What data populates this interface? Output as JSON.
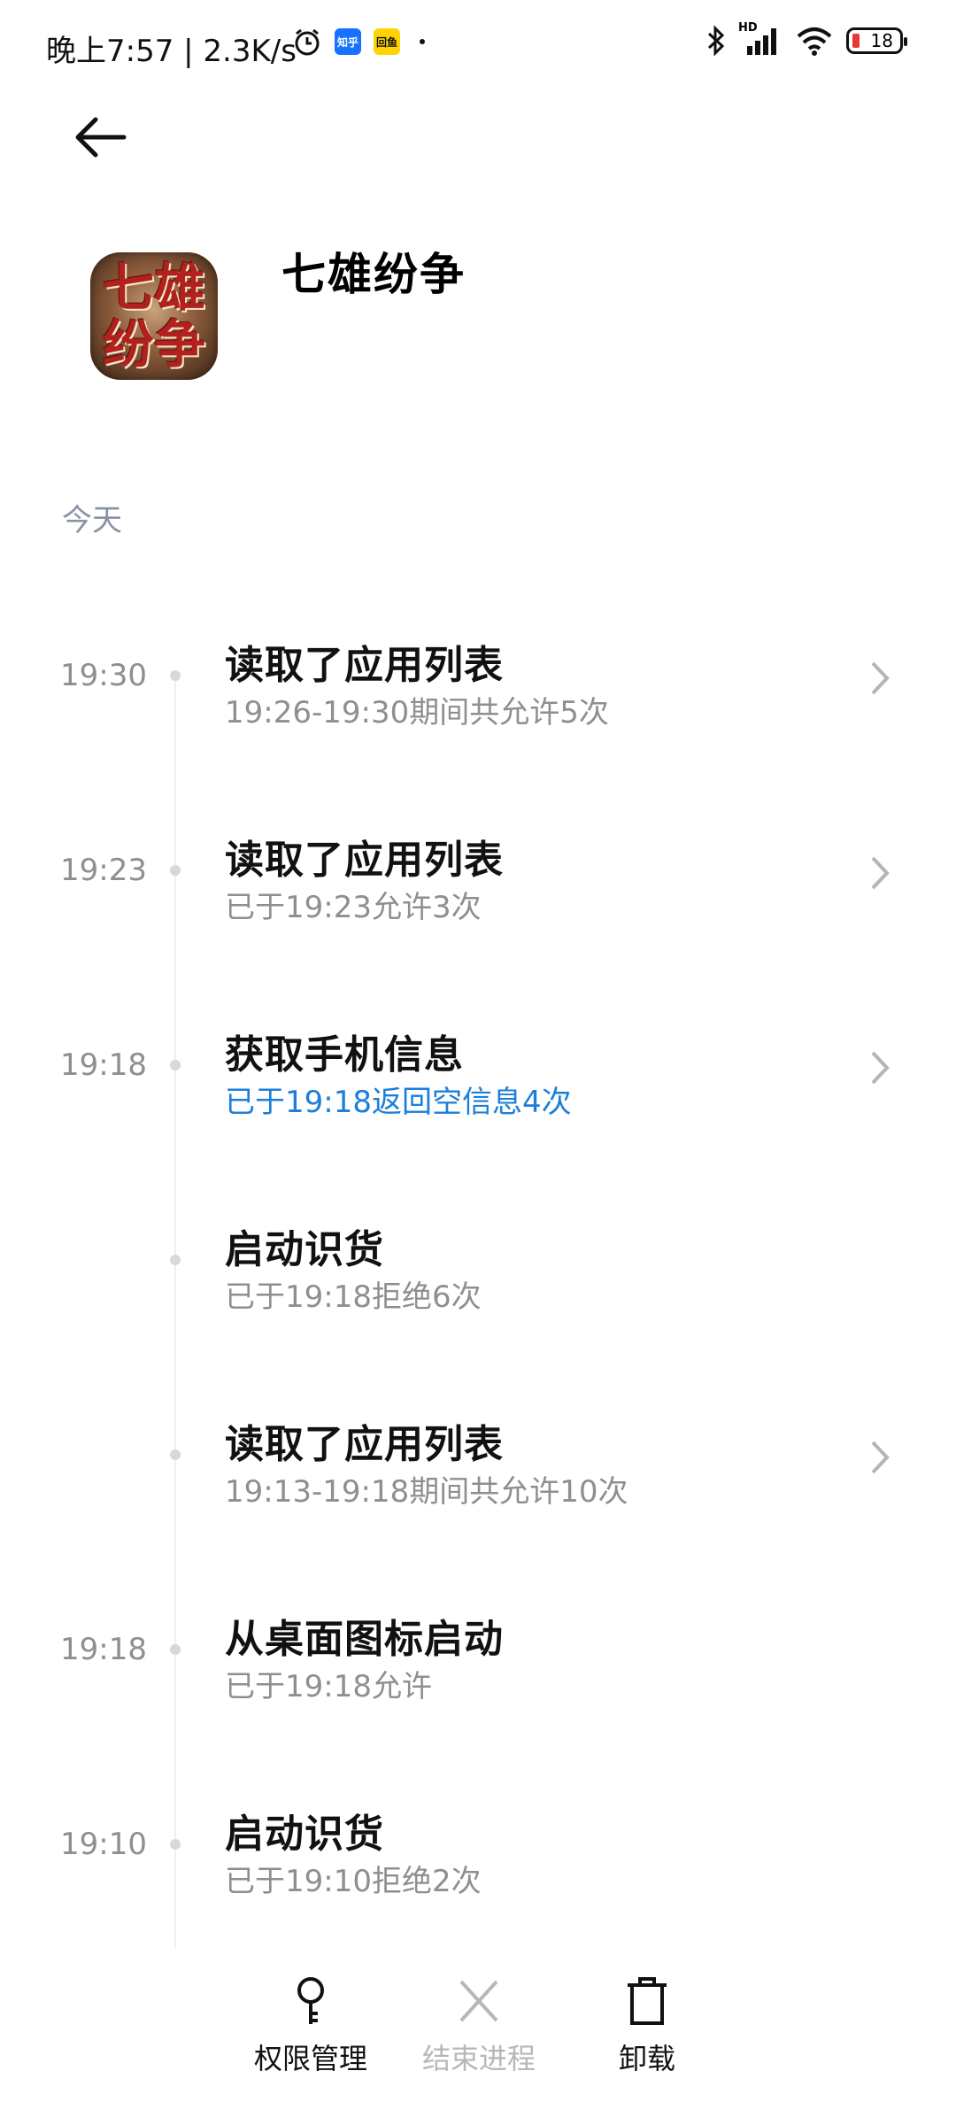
{
  "status_bar": {
    "time": "晚上7:57 | 2.3K/s",
    "battery": "18",
    "app_badges": [
      "知乎",
      "回鱼"
    ],
    "signal": "HD"
  },
  "app": {
    "name": "七雄纷争",
    "icon_text": "七雄纷争"
  },
  "section": {
    "label": "今天"
  },
  "entries": [
    {
      "time": "19:30",
      "title": "读取了应用列表",
      "subtitle": "19:26-19:30期间共允许5次",
      "has_chevron": true,
      "subtitle_color": "gray"
    },
    {
      "time": "19:23",
      "title": "读取了应用列表",
      "subtitle": "已于19:23允许3次",
      "has_chevron": true,
      "subtitle_color": "gray"
    },
    {
      "time": "19:18",
      "title": "获取手机信息",
      "subtitle": "已于19:18返回空信息4次",
      "has_chevron": true,
      "subtitle_color": "blue"
    },
    {
      "time": "",
      "title": "启动识货",
      "subtitle": "已于19:18拒绝6次",
      "has_chevron": false,
      "subtitle_color": "gray"
    },
    {
      "time": "",
      "title": "读取了应用列表",
      "subtitle": "19:13-19:18期间共允许10次",
      "has_chevron": true,
      "subtitle_color": "gray"
    },
    {
      "time": "19:18",
      "title": "从桌面图标启动",
      "subtitle": "已于19:18允许",
      "has_chevron": false,
      "subtitle_color": "gray"
    },
    {
      "time": "19:10",
      "title": "启动识货",
      "subtitle": "已于19:10拒绝2次",
      "has_chevron": false,
      "subtitle_color": "gray"
    }
  ],
  "bottom_actions": [
    {
      "label": "权限管理",
      "icon": "key-icon",
      "enabled": true
    },
    {
      "label": "结束进程",
      "icon": "close-icon",
      "enabled": false
    },
    {
      "label": "卸载",
      "icon": "trash-icon",
      "enabled": true
    }
  ],
  "colors": {
    "accent_blue": "#1b7fd9",
    "gray_text": "#8e8e93",
    "section_label": "#8a93a6"
  }
}
